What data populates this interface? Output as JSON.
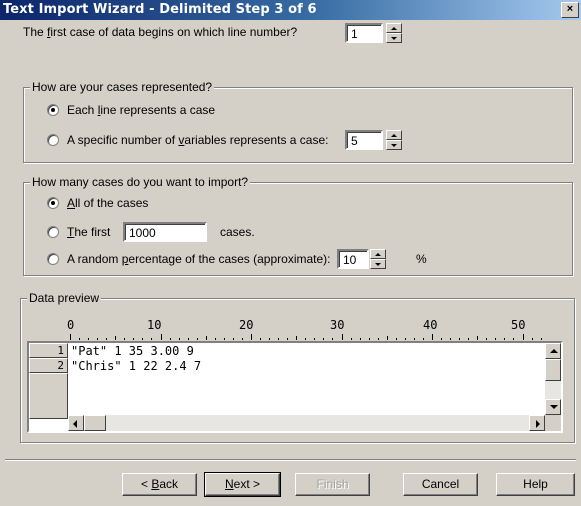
{
  "window": {
    "title": "Text Import Wizard - Delimited Step 3 of 6",
    "close_glyph": "×"
  },
  "first_line": {
    "label_pre": "The ",
    "label_accel": "f",
    "label_post": "irst case of data begins on which line number?",
    "value": "1"
  },
  "cases_group": {
    "legend": "How are your cases represented?",
    "option_each_pre": "Each ",
    "option_each_accel": "l",
    "option_each_post": "ine represents a case",
    "option_specific_pre": "A specific number of ",
    "option_specific_accel": "v",
    "option_specific_post": "ariables represents a case:",
    "specific_value": "5",
    "selected": "each"
  },
  "import_group": {
    "legend": "How many cases do you want to import?",
    "option_all_accel": "A",
    "option_all_post": "ll of the cases",
    "option_first_accel": "T",
    "option_first_post": "he first",
    "first_value": "1000",
    "first_suffix": "cases.",
    "option_random_pre": "A random ",
    "option_random_accel": "p",
    "option_random_post": "ercentage of the cases (approximate):",
    "random_value": "10",
    "random_suffix": "%",
    "selected": "all"
  },
  "preview": {
    "legend": "Data preview",
    "ruler_labels": [
      "0",
      "10",
      "20",
      "30",
      "40",
      "50"
    ],
    "rows": [
      {
        "num": "1",
        "text": "\"Pat\" 1 35 3.00 9"
      },
      {
        "num": "2",
        "text": "\"Chris\" 1 22 2.4 7"
      }
    ]
  },
  "buttons": {
    "back": {
      "pre": "< ",
      "accel": "B",
      "post": "ack"
    },
    "next": {
      "accel": "N",
      "post": "ext >"
    },
    "finish": "Finish",
    "cancel": "Cancel",
    "help": "Help"
  }
}
